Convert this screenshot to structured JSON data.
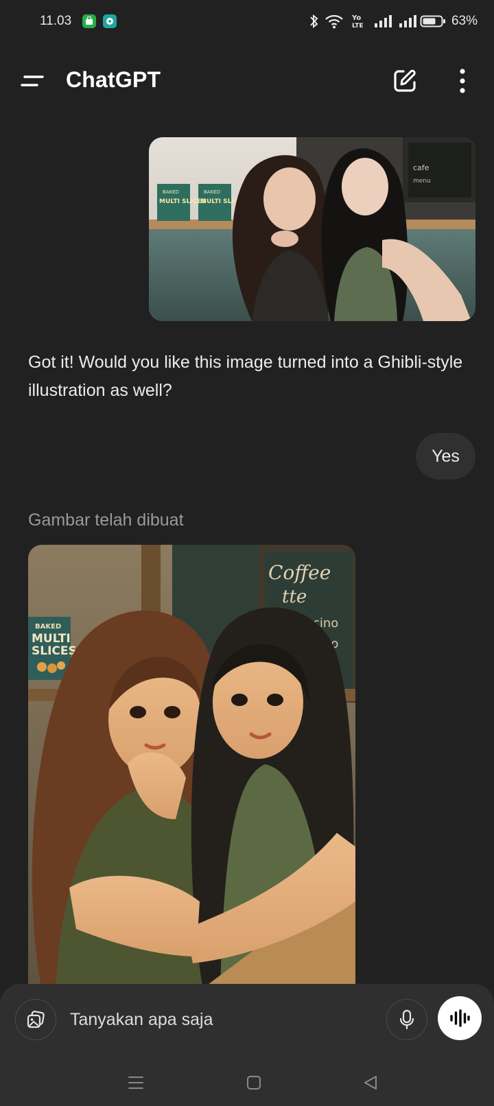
{
  "status_bar": {
    "time": "11.03",
    "battery": "63%",
    "icons": [
      "bluetooth-icon",
      "wifi-icon",
      "volte-icon",
      "signal-icon",
      "signal-icon",
      "battery-icon"
    ]
  },
  "app_bar": {
    "title": "ChatGPT",
    "icons": [
      "menu-icon",
      "new-chat-icon",
      "more-vert-icon"
    ]
  },
  "conversation": {
    "assistant_message": "Got it! Would you like this image turned into a Ghibli-style illustration as well?",
    "user_message": "Yes",
    "generated_label": "Gambar telah dibuat",
    "user_photo_signs": [
      "BAKED",
      "MULTI SLICES",
      "BAKED",
      "MULTI SLICES"
    ],
    "generated_image_signs": [
      "BAKED",
      "MULTI",
      "SLICES",
      "Coffee",
      "tte",
      "cino",
      "no"
    ]
  },
  "composer": {
    "placeholder": "Tanyakan apa saja",
    "icons": [
      "attach-image-icon",
      "mic-icon",
      "voice-mode-icon"
    ]
  },
  "nav_bar": {
    "icons": [
      "recents-icon",
      "home-icon",
      "back-icon"
    ]
  },
  "colors": {
    "background": "#212121",
    "bubble": "#303030",
    "composer": "#2f2f2f",
    "text": "#ececec",
    "muted": "#9a9a9a"
  }
}
